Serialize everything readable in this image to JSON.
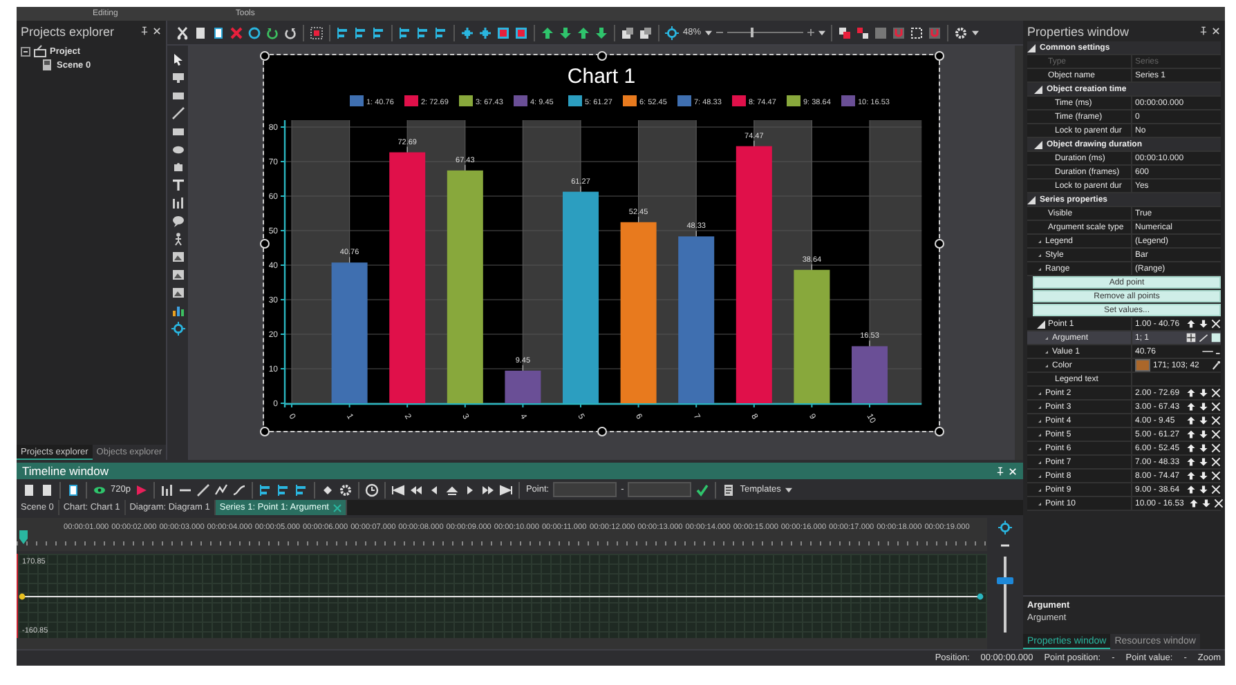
{
  "ribbon_groups": [
    "Editing",
    "Tools"
  ],
  "projects_explorer": {
    "title": "Projects explorer",
    "tree": [
      {
        "label": "Project",
        "expanded": true,
        "children": [
          {
            "label": "Scene 0"
          }
        ]
      }
    ],
    "tabs": [
      {
        "label": "Projects explorer",
        "selected": true
      },
      {
        "label": "Objects explorer",
        "selected": false
      }
    ]
  },
  "toolbar": {
    "zoom": "48%",
    "zoom_slider": {
      "level": 0.33
    }
  },
  "chart": {
    "chart_data": {
      "type": "bar",
      "title": "Chart 1",
      "x": [
        1,
        2,
        3,
        4,
        5,
        6,
        7,
        8,
        9,
        10
      ],
      "values": [
        40.76,
        72.69,
        67.43,
        9.45,
        61.27,
        52.45,
        48.33,
        74.47,
        38.64,
        16.53
      ],
      "xlim": [
        0,
        10.9
      ],
      "ylim": [
        0,
        82
      ],
      "xticks": [
        0,
        1,
        2,
        3,
        4,
        5,
        6,
        7,
        8,
        9,
        10
      ],
      "yticks": [
        0,
        10,
        20,
        30,
        40,
        50,
        60,
        70,
        80
      ],
      "data_labels": true,
      "grid": true
    },
    "legend": [
      {
        "label": "1: 40.76",
        "color": "#3f6fb0"
      },
      {
        "label": "2: 72.69",
        "color": "#e0104a"
      },
      {
        "label": "3: 67.43",
        "color": "#88a83c"
      },
      {
        "label": "4: 9.45",
        "color": "#6a4f96"
      },
      {
        "label": "5: 61.27",
        "color": "#2c9ec0"
      },
      {
        "label": "6: 52.45",
        "color": "#e87a1e"
      },
      {
        "label": "7: 48.33",
        "color": "#3f6fb0"
      },
      {
        "label": "8: 74.47",
        "color": "#e0104a"
      },
      {
        "label": "9: 38.64",
        "color": "#88a83c"
      },
      {
        "label": "10: 16.53",
        "color": "#6a4f96"
      }
    ]
  },
  "timeline": {
    "title": "Timeline window",
    "resolution": "720p",
    "point_label": "Point:",
    "point_separator": "-",
    "templates": "Templates",
    "tabs": [
      {
        "label": "Scene 0",
        "selected": false
      },
      {
        "label": "Chart: Chart 1",
        "selected": false
      },
      {
        "label": "Diagram: Diagram 1",
        "selected": false
      },
      {
        "label": "Series 1: Point 1: Argument",
        "selected": true
      }
    ],
    "ruler": [
      "00:00:01.000",
      "00:00:02.000",
      "00:00:03.000",
      "00:00:04.000",
      "00:00:05.000",
      "00:00:06.000",
      "00:00:07.000",
      "00:00:08.000",
      "00:00:09.000",
      "00:00:10.000",
      "00:00:11.000",
      "00:00:12.000",
      "00:00:13.000",
      "00:00:14.000",
      "00:00:15.000",
      "00:00:16.000",
      "00:00:17.000",
      "00:00:18.000",
      "00:00:19.000"
    ],
    "graph": {
      "max": "170.85",
      "min": "-160.85"
    },
    "zoom_slider": {
      "level": 0.68
    }
  },
  "properties": {
    "title": "Properties window",
    "grid": [
      {
        "kind": "group",
        "label": "Common settings",
        "expanded": true,
        "children": [
          {
            "kind": "prop",
            "name": "Type",
            "value": "Series",
            "disabled": true
          },
          {
            "kind": "prop",
            "name": "Object name",
            "value": "Series 1"
          },
          {
            "kind": "group",
            "label": "Object creation time",
            "expanded": true,
            "children": [
              {
                "kind": "prop",
                "name": "Time (ms)",
                "value": "00:00:00.000"
              },
              {
                "kind": "prop",
                "name": "Time (frame)",
                "value": "0"
              },
              {
                "kind": "prop",
                "name": "Lock to parent dur",
                "value": "No"
              }
            ]
          },
          {
            "kind": "group",
            "label": "Object drawing duration",
            "expanded": true,
            "children": [
              {
                "kind": "prop",
                "name": "Duration (ms)",
                "value": "00:00:10.000"
              },
              {
                "kind": "prop",
                "name": "Duration (frames)",
                "value": "600"
              },
              {
                "kind": "prop",
                "name": "Lock to parent dur",
                "value": "Yes"
              }
            ]
          }
        ]
      },
      {
        "kind": "group",
        "label": "Series properties",
        "expanded": true,
        "children": [
          {
            "kind": "prop",
            "name": "Visible",
            "value": "True"
          },
          {
            "kind": "prop",
            "name": "Argument scale type",
            "value": "Numerical"
          },
          {
            "kind": "prop",
            "name": "Legend",
            "value": "(Legend)",
            "expanded": false
          },
          {
            "kind": "prop",
            "name": "Style",
            "value": "Bar",
            "expanded": false
          },
          {
            "kind": "prop",
            "name": "Range",
            "value": "(Range)",
            "expanded": false
          },
          {
            "kind": "action",
            "label": "Add point"
          },
          {
            "kind": "action",
            "label": "Remove all points"
          },
          {
            "kind": "action",
            "label": "Set values..."
          },
          {
            "kind": "point",
            "name": "Point 1",
            "value": "1.00 - 40.76",
            "expanded": true,
            "children": [
              {
                "kind": "link",
                "name": "Argument",
                "value": "1; 1",
                "expanded": false,
                "selected": true
              },
              {
                "kind": "number",
                "name": "Value 1",
                "value": "40.76",
                "expanded": false,
                "selected": false
              },
              {
                "kind": "color",
                "name": "Color",
                "value": "171; 103; 42",
                "color": "#ab672a",
                "expanded": false,
                "selected": false
              },
              {
                "kind": "prop",
                "name": "Legend text",
                "selected": false
              }
            ]
          },
          {
            "kind": "point",
            "name": "Point 2",
            "value": "2.00 - 72.69",
            "expanded": false
          },
          {
            "kind": "point",
            "name": "Point 3",
            "value": "3.00 - 67.43",
            "expanded": false
          },
          {
            "kind": "point",
            "name": "Point 4",
            "value": "4.00 - 9.45",
            "expanded": false
          },
          {
            "kind": "point",
            "name": "Point 5",
            "value": "5.00 - 61.27",
            "expanded": false
          },
          {
            "kind": "point",
            "name": "Point 6",
            "value": "6.00 - 52.45",
            "expanded": false
          },
          {
            "kind": "point",
            "name": "Point 7",
            "value": "7.00 - 48.33",
            "expanded": false
          },
          {
            "kind": "point",
            "name": "Point 8",
            "value": "8.00 - 74.47",
            "expanded": false
          },
          {
            "kind": "point",
            "name": "Point 9",
            "value": "9.00 - 38.64",
            "expanded": false
          },
          {
            "kind": "point",
            "name": "Point 10",
            "value": "10.00 - 16.53",
            "expanded": false
          }
        ]
      }
    ],
    "description": {
      "title": "Argument",
      "text": "Argument"
    },
    "tabs": [
      {
        "label": "Properties window",
        "selected": true
      },
      {
        "label": "Resources window",
        "selected": false
      }
    ]
  },
  "status_bar": [
    {
      "label": "Position:",
      "value": "00:00:00.000"
    },
    {
      "label": "Point position:",
      "value": "-"
    },
    {
      "label": "Point value:",
      "value": "-"
    },
    {
      "label": "Zoom"
    }
  ]
}
